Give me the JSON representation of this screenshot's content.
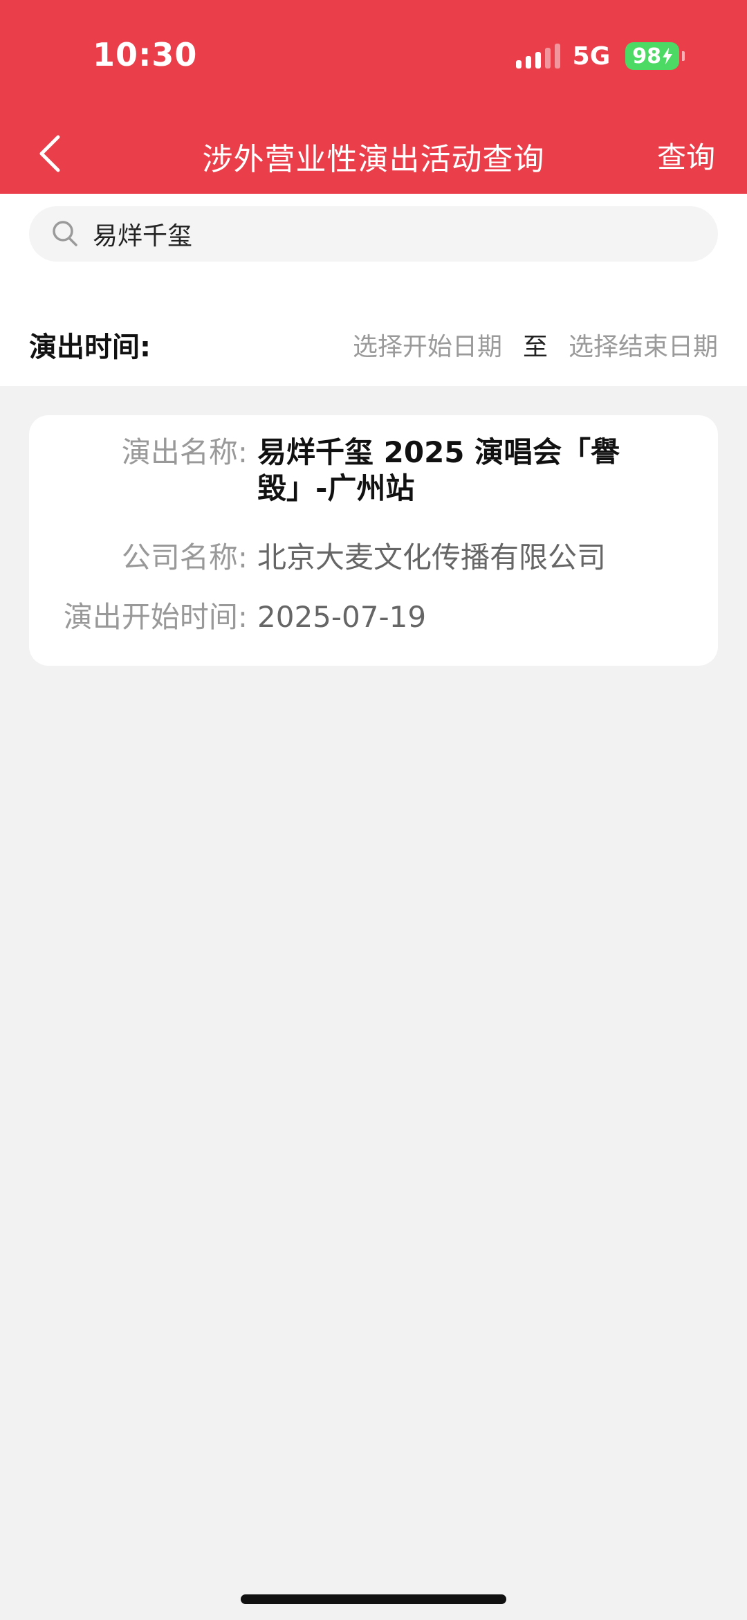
{
  "status_bar": {
    "time": "10:30",
    "network": "5G",
    "battery": "98"
  },
  "nav": {
    "title": "涉外营业性演出活动查询",
    "action": "查询"
  },
  "search": {
    "value": "易烊千玺"
  },
  "filter": {
    "label": "演出时间:",
    "start_placeholder": "选择开始日期",
    "to": "至",
    "end_placeholder": "选择结束日期"
  },
  "result": {
    "name_label": "演出名称:",
    "name_value": "易烊千玺 2025 演唱会「譽毀」-广州站",
    "company_label": "公司名称:",
    "company_value": "北京大麦文化传播有限公司",
    "start_label": "演出开始时间:",
    "start_value": "2025-07-19"
  },
  "colors": {
    "accent": "#ea3f4b",
    "battery": "#4cd964",
    "page_bg": "#f2f2f2"
  },
  "icons": [
    "back-chevron-icon",
    "search-icon",
    "signal-icon",
    "battery-icon"
  ]
}
